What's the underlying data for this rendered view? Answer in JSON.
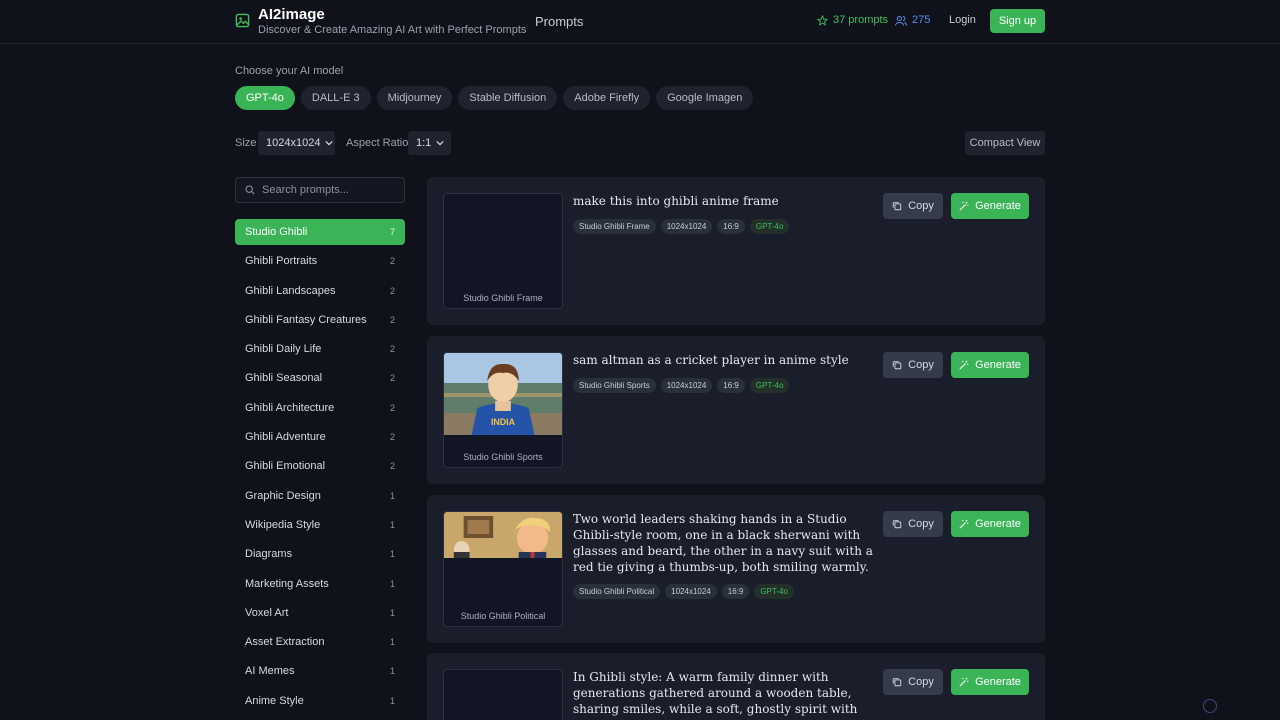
{
  "header": {
    "brand_title": "AI2image",
    "brand_subtitle": "Discover & Create Amazing AI Art with Perfect Prompts",
    "nav_prompts": "Prompts",
    "prompts_count": "37 prompts",
    "users_count": "275",
    "login": "Login",
    "signup": "Sign up"
  },
  "model_chooser": {
    "label": "Choose your AI model",
    "models": [
      "GPT-4o",
      "DALL-E 3",
      "Midjourney",
      "Stable Diffusion",
      "Adobe Firefly",
      "Google Imagen"
    ],
    "selected": "GPT-4o"
  },
  "options": {
    "size_label": "Size",
    "size_value": "1024x1024",
    "aspect_label": "Aspect Ratio",
    "aspect_value": "1:1",
    "compact_view": "Compact View"
  },
  "sidebar": {
    "search_placeholder": "Search prompts...",
    "categories": [
      {
        "label": "Studio Ghibli",
        "count": "7",
        "active": true
      },
      {
        "label": "Ghibli Portraits",
        "count": "2"
      },
      {
        "label": "Ghibli Landscapes",
        "count": "2"
      },
      {
        "label": "Ghibli Fantasy Creatures",
        "count": "2"
      },
      {
        "label": "Ghibli Daily Life",
        "count": "2"
      },
      {
        "label": "Ghibli Seasonal",
        "count": "2"
      },
      {
        "label": "Ghibli Architecture",
        "count": "2"
      },
      {
        "label": "Ghibli Adventure",
        "count": "2"
      },
      {
        "label": "Ghibli Emotional",
        "count": "2"
      },
      {
        "label": "Graphic Design",
        "count": "1"
      },
      {
        "label": "Wikipedia Style",
        "count": "1"
      },
      {
        "label": "Diagrams",
        "count": "1"
      },
      {
        "label": "Marketing Assets",
        "count": "1"
      },
      {
        "label": "Voxel Art",
        "count": "1"
      },
      {
        "label": "Asset Extraction",
        "count": "1"
      },
      {
        "label": "AI Memes",
        "count": "1"
      },
      {
        "label": "Anime Style",
        "count": "1"
      }
    ]
  },
  "cards": [
    {
      "thumb_caption": "Studio Ghibli Frame",
      "prompt": "make this into ghibli anime frame",
      "tags": [
        "Studio Ghibli Frame",
        "1024x1024",
        "16:9"
      ],
      "model": "GPT-4o",
      "copy": "Copy",
      "generate": "Generate"
    },
    {
      "thumb_caption": "Studio Ghibli Sports",
      "prompt": "sam altman as a cricket player in anime style",
      "tags": [
        "Studio Ghibli Sports",
        "1024x1024",
        "16:9"
      ],
      "model": "GPT-4o",
      "copy": "Copy",
      "generate": "Generate",
      "jersey_text": "INDIA"
    },
    {
      "thumb_caption": "Studio Ghibli Political",
      "prompt": "Two world leaders shaking hands in a Studio Ghibli-style room, one in a black sherwani with glasses and beard, the other in a navy suit with a red tie giving a thumbs-up, both smiling warmly.",
      "tags": [
        "Studio Ghibli Political",
        "1024x1024",
        "16:9"
      ],
      "model": "GPT-4o",
      "copy": "Copy",
      "generate": "Generate"
    },
    {
      "thumb_caption": "",
      "prompt": "In Ghibli style: A warm family dinner with generations gathered around a wooden table, sharing smiles, while a soft, ghostly spirit with black eyes peeks from an attic",
      "copy": "Copy",
      "generate": "Generate"
    }
  ],
  "colors": {
    "accent": "#3bb457",
    "background": "#0f121b",
    "card": "#1a1e2a"
  }
}
